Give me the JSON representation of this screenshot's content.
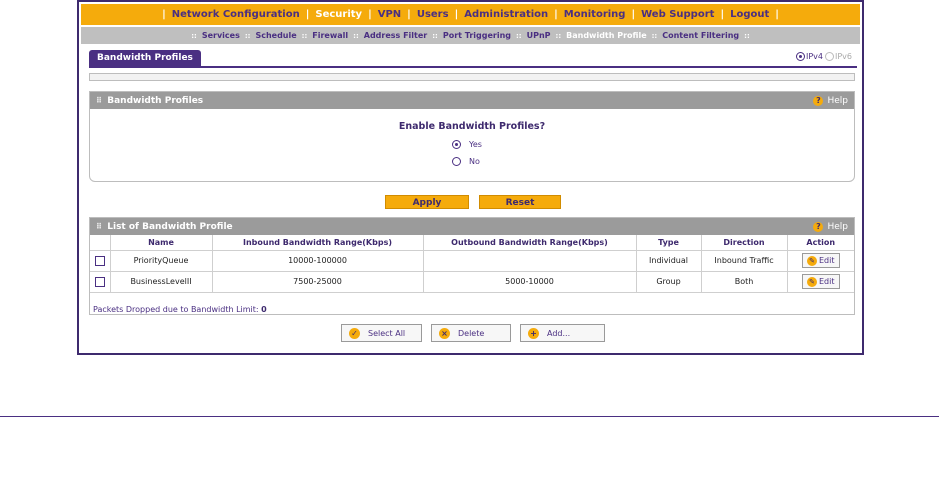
{
  "top_nav": {
    "items": [
      "Network Configuration",
      "Security",
      "VPN",
      "Users",
      "Administration",
      "Monitoring",
      "Web Support",
      "Logout"
    ],
    "active": "Security"
  },
  "sub_nav": {
    "items": [
      "Services",
      "Schedule",
      "Firewall",
      "Address Filter",
      "Port Triggering",
      "UPnP",
      "Bandwidth Profile",
      "Content Filtering"
    ],
    "active": "Bandwidth Profile"
  },
  "tab_title": "Bandwidth Profiles",
  "ip_version": {
    "options": [
      "IPv4",
      "IPv6"
    ],
    "selected": "IPv4"
  },
  "profiles_section": {
    "title": "Bandwidth Profiles",
    "help_label": "Help",
    "question": "Enable Bandwidth Profiles?",
    "options": [
      "Yes",
      "No"
    ],
    "selected": "Yes"
  },
  "buttons": {
    "apply": "Apply",
    "reset": "Reset"
  },
  "list_section": {
    "title": "List of Bandwidth Profile",
    "help_label": "Help",
    "columns": [
      "Name",
      "Inbound Bandwidth Range(Kbps)",
      "Outbound Bandwidth Range(Kbps)",
      "Type",
      "Direction",
      "Action"
    ],
    "rows": [
      {
        "name": "PriorityQueue",
        "inbound": "10000-100000",
        "outbound": "",
        "type": "Individual",
        "direction": "Inbound Traffic",
        "action": "Edit"
      },
      {
        "name": "BusinessLevelII",
        "inbound": "7500-25000",
        "outbound": "5000-10000",
        "type": "Group",
        "direction": "Both",
        "action": "Edit"
      }
    ]
  },
  "packets_dropped": {
    "label": "Packets Dropped due to Bandwidth Limit:",
    "value": "0"
  },
  "actions": {
    "select_all": "Select All",
    "delete": "Delete",
    "add": "Add..."
  },
  "colors": {
    "accent": "#f5ab0c",
    "brand": "#4a2f82",
    "section_header": "#9b9b9b"
  }
}
